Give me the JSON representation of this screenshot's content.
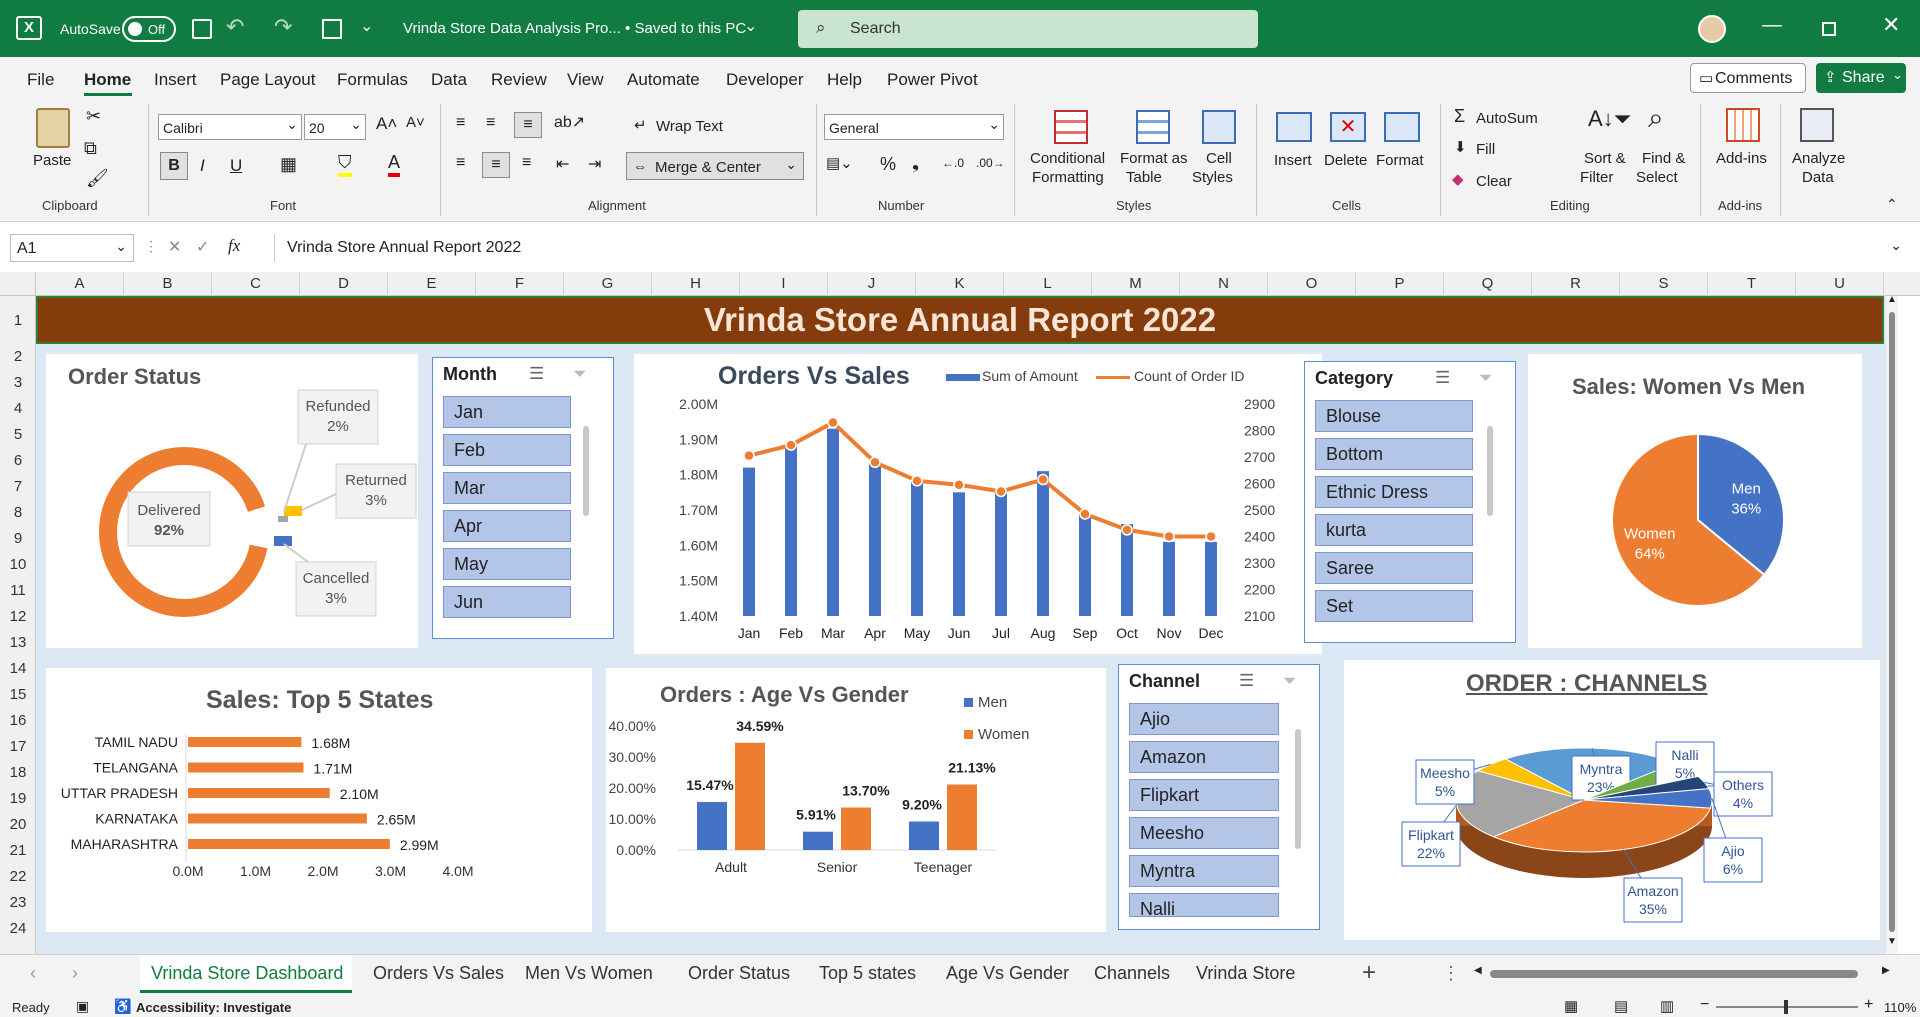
{
  "window": {
    "autosave": "AutoSave",
    "toggle": "Off",
    "title": "Vrinda Store Data Analysis Pro... • Saved to this PC",
    "search": "Search"
  },
  "menu": [
    "File",
    "Home",
    "Insert",
    "Page Layout",
    "Formulas",
    "Data",
    "Review",
    "View",
    "Automate",
    "Developer",
    "Help",
    "Power Pivot"
  ],
  "menu_comments": "Comments",
  "menu_share": "Share",
  "ribbon": {
    "paste": "Paste",
    "clipboard": "Clipboard",
    "font_name": "Calibri",
    "font_size": "20",
    "font": "Font",
    "wrap": "Wrap Text",
    "merge": "Merge & Center",
    "alignment": "Alignment",
    "numfmt": "General",
    "number": "Number",
    "cond1": "Conditional",
    "cond2": "Formatting",
    "fmt1": "Format as",
    "fmt2": "Table",
    "cs1": "Cell",
    "cs2": "Styles",
    "styles": "Styles",
    "insert": "Insert",
    "delete": "Delete",
    "format": "Format",
    "cells": "Cells",
    "autosum": "AutoSum",
    "fill": "Fill",
    "clear": "Clear",
    "sort1": "Sort &",
    "sort2": "Filter",
    "find1": "Find &",
    "find2": "Select",
    "editing": "Editing",
    "addins": "Add-ins",
    "addins_grp": "Add-ins",
    "analyze1": "Analyze",
    "analyze2": "Data"
  },
  "formula": {
    "cell": "A1",
    "content": "Vrinda Store Annual Report 2022"
  },
  "columns": [
    "A",
    "B",
    "C",
    "D",
    "E",
    "F",
    "G",
    "H",
    "I",
    "J",
    "K",
    "L",
    "M",
    "N",
    "O",
    "P",
    "Q",
    "R",
    "S",
    "T",
    "U"
  ],
  "rows": [
    "1",
    "2",
    "3",
    "4",
    "5",
    "6",
    "7",
    "8",
    "9",
    "10",
    "11",
    "12",
    "13",
    "14",
    "15",
    "16",
    "17",
    "18",
    "19",
    "20",
    "21",
    "22",
    "23",
    "24"
  ],
  "banner": "Vrinda Store Annual Report 2022",
  "order_status": {
    "title": "Order Status",
    "labels": [
      {
        "name": "Delivered",
        "pct": "92%"
      },
      {
        "name": "Refunded",
        "pct": "2%"
      },
      {
        "name": "Returned",
        "pct": "3%"
      },
      {
        "name": "Cancelled",
        "pct": "3%"
      }
    ]
  },
  "month_slicer": {
    "title": "Month",
    "items": [
      "Jan",
      "Feb",
      "Mar",
      "Apr",
      "May",
      "Jun"
    ]
  },
  "category_slicer": {
    "title": "Category",
    "items": [
      "Blouse",
      "Bottom",
      "Ethnic Dress",
      "kurta",
      "Saree",
      "Set"
    ]
  },
  "channel_slicer": {
    "title": "Channel",
    "items": [
      "Ajio",
      "Amazon",
      "Flipkart",
      "Meesho",
      "Myntra",
      "Nalli"
    ]
  },
  "orders_sales": {
    "title": "Orders Vs Sales",
    "legend1": "Sum of Amount",
    "legend2": "Count of Order ID"
  },
  "women_men": {
    "title": "Sales: Women Vs Men"
  },
  "states": {
    "title": "Sales: Top 5 States"
  },
  "age_gender": {
    "title": "Orders : Age Vs Gender",
    "legend1": "Men",
    "legend2": "Women"
  },
  "channels": {
    "title": "ORDER : CHANNELS"
  },
  "chart_data": [
    {
      "type": "pie",
      "title": "Order Status",
      "labels": [
        "Delivered",
        "Refunded",
        "Returned",
        "Cancelled"
      ],
      "values": [
        92,
        2,
        3,
        3
      ],
      "colors": [
        "#ed7d31",
        "#a5a5a5",
        "#ffc000",
        "#4472c4"
      ]
    },
    {
      "type": "bar",
      "title": "Orders Vs Sales",
      "categories": [
        "Jan",
        "Feb",
        "Mar",
        "Apr",
        "May",
        "Jun",
        "Jul",
        "Aug",
        "Sep",
        "Oct",
        "Nov",
        "Dec"
      ],
      "series": [
        {
          "name": "Sum of Amount",
          "values": [
            1.82,
            1.88,
            1.93,
            1.83,
            1.78,
            1.75,
            1.76,
            1.81,
            1.69,
            1.66,
            1.61,
            1.61
          ],
          "color": "#4472c4"
        },
        {
          "name": "Count of Order ID",
          "values": [
            2705,
            2745,
            2830,
            2680,
            2610,
            2595,
            2570,
            2615,
            2485,
            2425,
            2400,
            2400
          ],
          "color": "#ed7d31",
          "axis": "right"
        }
      ],
      "ylim": [
        1.4,
        2.0
      ],
      "yticks": [
        "2.00M",
        "1.90M",
        "1.80M",
        "1.70M",
        "1.60M",
        "1.50M",
        "1.40M"
      ],
      "y2lim": [
        2100,
        2900
      ],
      "y2ticks": [
        "2900",
        "2800",
        "2700",
        "2600",
        "2500",
        "2400",
        "2300",
        "2200",
        "2100"
      ]
    },
    {
      "type": "pie",
      "title": "Sales: Women Vs Men",
      "labels": [
        "Men",
        "Women"
      ],
      "values": [
        36,
        64
      ],
      "pct_labels": [
        "36%",
        "64%"
      ],
      "colors": [
        "#4472c4",
        "#ed7d31"
      ]
    },
    {
      "type": "bar",
      "title": "Sales: Top 5 States",
      "categories": [
        "TAMIL NADU",
        "TELANGANA",
        "UTTAR PRADESH",
        "KARNATAKA",
        "MAHARASHTRA"
      ],
      "values": [
        1.68,
        1.71,
        2.1,
        2.65,
        2.99
      ],
      "data_labels": [
        "1.68M",
        "1.71M",
        "2.10M",
        "2.65M",
        "2.99M"
      ],
      "xlim": [
        0,
        4
      ],
      "xticks": [
        "0.0M",
        "1.0M",
        "2.0M",
        "3.0M",
        "4.0M"
      ],
      "color": "#ed7d31"
    },
    {
      "type": "bar",
      "title": "Orders : Age Vs Gender",
      "categories": [
        "Adult",
        "Senior",
        "Teenager"
      ],
      "series": [
        {
          "name": "Men",
          "values": [
            15.47,
            5.91,
            9.2
          ],
          "data_labels": [
            "15.47%",
            "5.91%",
            "9.20%"
          ],
          "color": "#4472c4"
        },
        {
          "name": "Women",
          "values": [
            34.59,
            13.7,
            21.13
          ],
          "data_labels": [
            "34.59%",
            "13.70%",
            "21.13%"
          ],
          "color": "#ed7d31"
        }
      ],
      "ylim": [
        0,
        40
      ],
      "yticks": [
        "40.00%",
        "30.00%",
        "20.00%",
        "10.00%",
        "0.00%"
      ]
    },
    {
      "type": "pie",
      "title": "ORDER : CHANNELS",
      "labels": [
        "Amazon",
        "Flipkart",
        "Meesho",
        "Myntra",
        "Nalli",
        "Others",
        "Ajio"
      ],
      "values": [
        35,
        22,
        5,
        23,
        5,
        4,
        6
      ],
      "pct_labels": [
        "35%",
        "22%",
        "5%",
        "23%",
        "5%",
        "4%",
        "6%"
      ],
      "colors": [
        "#ed7d31",
        "#a5a5a5",
        "#ffc000",
        "#5b9bd5",
        "#70ad47",
        "#264478",
        "#4472c4"
      ]
    }
  ],
  "sheets": [
    "Vrinda Store Dashboard",
    "Orders Vs Sales",
    "Men Vs Women",
    "Order Status",
    "Top 5 states",
    "Age Vs Gender",
    "Channels",
    "Vrinda Store"
  ],
  "status": {
    "ready": "Ready",
    "accessibility": "Accessibility: Investigate",
    "zoom": "110%"
  }
}
